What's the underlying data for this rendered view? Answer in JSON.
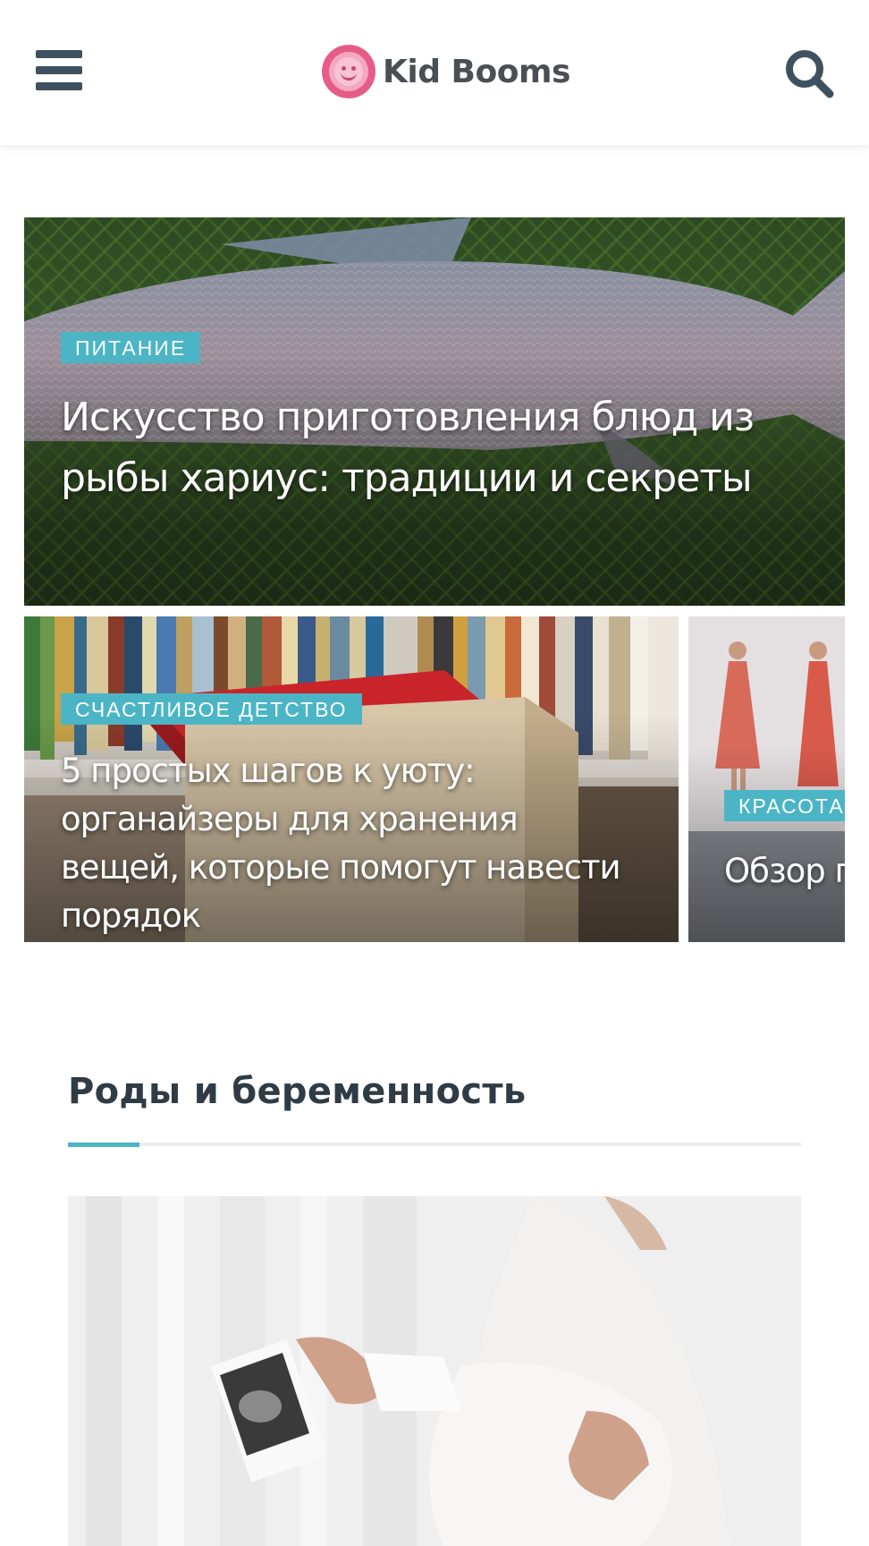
{
  "header": {
    "logo_text": "Kid Booms",
    "menu_icon": "hamburger-menu-icon",
    "search_icon": "search-icon",
    "brand_pink": "#e55d86",
    "icon_color": "#3f5160"
  },
  "featured": {
    "accent_color": "#4bb5c5",
    "cards": [
      {
        "category": "ПИТАНИЕ",
        "title": "Искусство приготовления блюд из рыбы хариус: традиции и секреты"
      },
      {
        "category": "СЧАСТЛИВОЕ ДЕТСТВО",
        "title": "5 простых шагов к уюту: органайзеры для хранения вещей, которые помогут навести порядок"
      },
      {
        "category": "КРАСОТА",
        "title": "Обзор платье"
      }
    ]
  },
  "section": {
    "title": "Роды и беременность"
  }
}
